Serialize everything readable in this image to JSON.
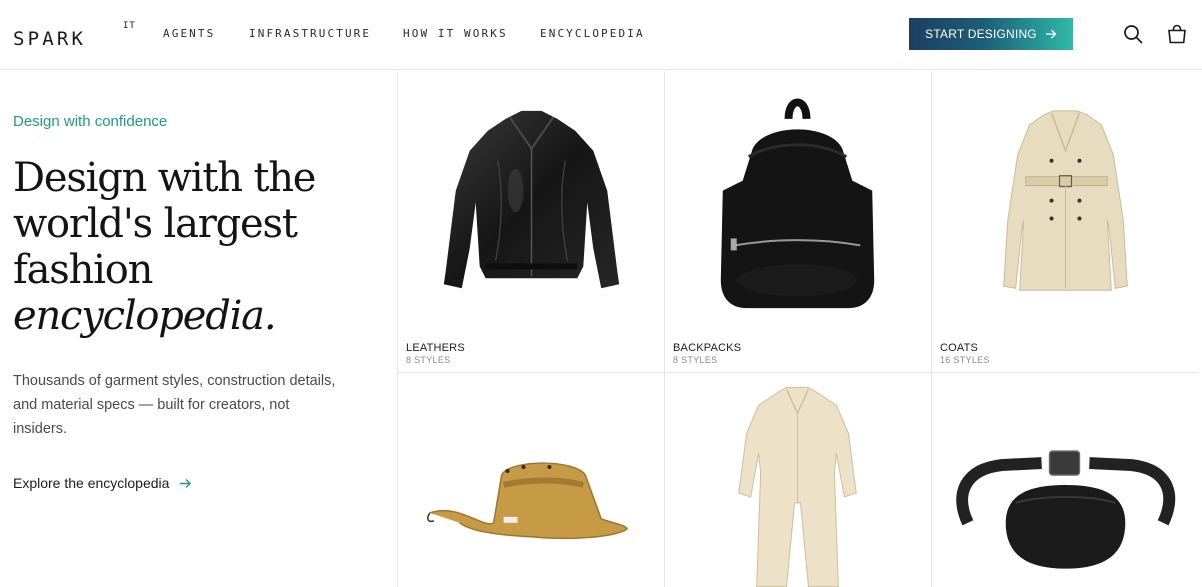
{
  "header": {
    "logo": "SPARK",
    "logo_sup": "IT",
    "nav": [
      {
        "label": "AGENTS"
      },
      {
        "label": "INFRASTRUCTURE"
      },
      {
        "label": "HOW IT WORKS"
      },
      {
        "label": "ENCYCLOPEDIA"
      }
    ],
    "cta_label": "START DESIGNING",
    "cta_gradient": [
      "#1d3f61",
      "#2fb9a8"
    ],
    "icons": [
      "search-icon",
      "shopping-bag-icon"
    ]
  },
  "hero": {
    "eyebrow": "Design with confidence",
    "headline_lines": [
      "Design with the",
      "world's largest",
      "fashion"
    ],
    "headline_italic": "encyclopedia.",
    "body": "Thousands of garment styles, construction details, and material specs — built for creators, not insiders.",
    "link_label": "Explore the encyclopedia",
    "accent_color": "#1f9a83"
  },
  "categories": [
    {
      "label": "LEATHERS",
      "count": "8 STYLES",
      "image": "leather-jacket"
    },
    {
      "label": "BACKPACKS",
      "count": "8 STYLES",
      "image": "backpack"
    },
    {
      "label": "COATS",
      "count": "16 STYLES",
      "image": "trench-coat"
    },
    {
      "label": "",
      "count": "",
      "image": "bucket-hat"
    },
    {
      "label": "",
      "count": "",
      "image": "jumpsuit"
    },
    {
      "label": "",
      "count": "",
      "image": "belt-bag"
    }
  ]
}
